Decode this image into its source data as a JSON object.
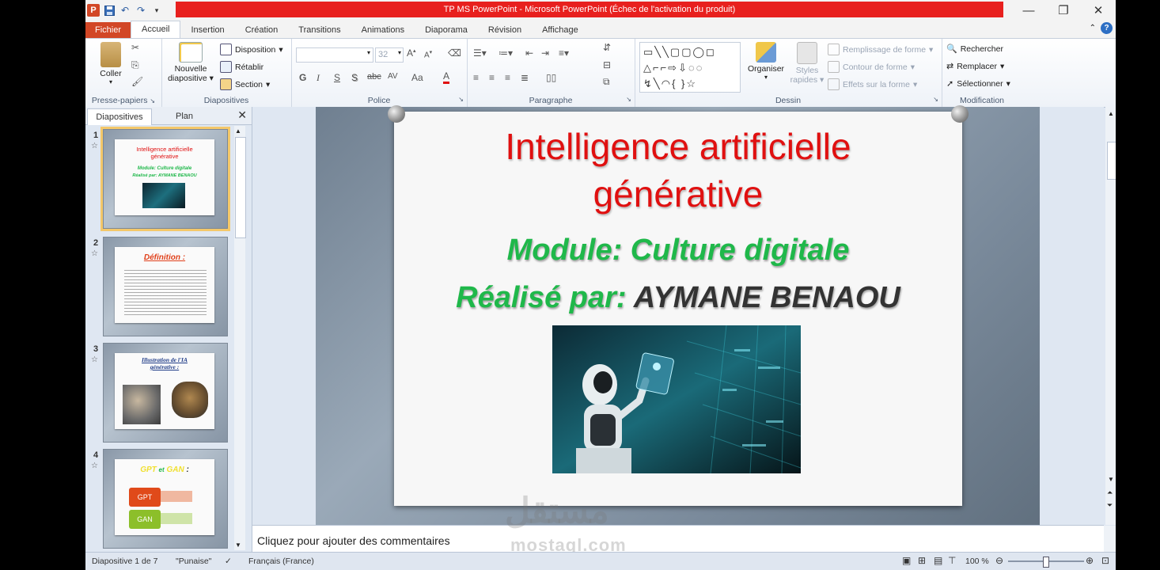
{
  "window": {
    "title": "TP MS PowerPoint - Microsoft PowerPoint (Échec de l'activation du produit)",
    "app_logo": "P"
  },
  "tabs": [
    "Fichier",
    "Accueil",
    "Insertion",
    "Création",
    "Transitions",
    "Animations",
    "Diaporama",
    "Révision",
    "Affichage"
  ],
  "active_tab": "Accueil",
  "ribbon": {
    "clipboard": {
      "paste": "Coller",
      "label": "Presse-papiers"
    },
    "slides": {
      "new_slide_1": "Nouvelle",
      "new_slide_2": "diapositive",
      "layout": "Disposition",
      "reset": "Rétablir",
      "section": "Section",
      "label": "Diapositives"
    },
    "font": {
      "size": "32",
      "label": "Police",
      "bold": "G",
      "italic": "I",
      "underline": "S",
      "shadow": "S",
      "strike": "abc",
      "spacing": "AV",
      "case": "Aa",
      "color": "A"
    },
    "paragraph": {
      "label": "Paragraphe"
    },
    "drawing": {
      "arrange": "Organiser",
      "quick_styles_1": "Styles",
      "quick_styles_2": "rapides",
      "shape_fill": "Remplissage de forme",
      "shape_outline": "Contour de forme",
      "shape_effects": "Effets sur la forme",
      "label": "Dessin"
    },
    "editing": {
      "find": "Rechercher",
      "replace": "Remplacer",
      "select": "Sélectionner",
      "label": "Modification"
    }
  },
  "slides_pane": {
    "tab_slides": "Diapositives",
    "tab_outline": "Plan",
    "thumbnails": [
      {
        "number": "1",
        "title_line1": "Intelligence artificielle",
        "title_line2": "générative",
        "sub1": "Module: Culture digitale",
        "sub2": "Réalisé par: AYMANE BENAOU"
      },
      {
        "number": "2",
        "title_line1": "Définition :"
      },
      {
        "number": "3",
        "title_line1": "Illustration de l'IA",
        "title_line2": "générative :"
      },
      {
        "number": "4",
        "title_line1": "GPT",
        "title_mid": "et",
        "title_line2": "GAN",
        "title_colon": ":",
        "box1": "GPT",
        "box2": "GAN"
      }
    ]
  },
  "slide": {
    "title_line1": "Intelligence artificielle",
    "title_line2": "générative",
    "module": "Module: Culture digitale",
    "author_label": "Réalisé par:",
    "author_name": "AYMANE BENAOU"
  },
  "notes": {
    "placeholder": "Cliquez pour ajouter des commentaires"
  },
  "status": {
    "slide_info": "Diapositive 1 de 7",
    "theme": "\"Punaise\"",
    "language": "Français (France)",
    "zoom": "100 %"
  },
  "watermark": {
    "arabic": "مستقل",
    "latin": "mostaql.com"
  },
  "colors": {
    "title_red": "#e01010",
    "green": "#1fb84a",
    "file_tab": "#d24726"
  }
}
